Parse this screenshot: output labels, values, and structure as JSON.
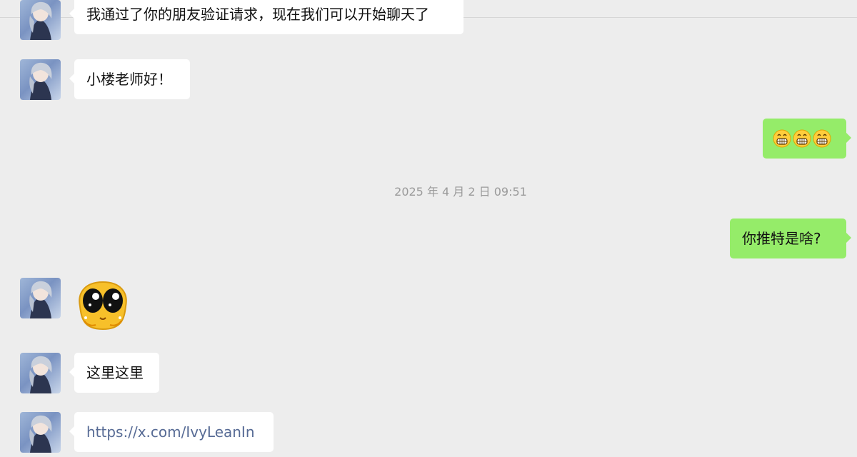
{
  "chat": {
    "messages": [
      {
        "side": "left",
        "type": "text",
        "text": "我通过了你的朋友验证请求，现在我们可以开始聊天了"
      },
      {
        "side": "left",
        "type": "text",
        "text": "小楼老师好！"
      },
      {
        "side": "right",
        "type": "emoji",
        "emoji": "grinning-face-icon",
        "count": 3
      },
      {
        "side": "center",
        "type": "timestamp",
        "text": "2025 年 4 月 2 日 09:51"
      },
      {
        "side": "right",
        "type": "text",
        "text": "你推特是啥?"
      },
      {
        "side": "left",
        "type": "sticker",
        "sticker": "pleading-eyes-sticker"
      },
      {
        "side": "left",
        "type": "text",
        "text": "这里这里"
      },
      {
        "side": "left",
        "type": "link",
        "text": "https://x.com/IvyLeanIn"
      }
    ]
  },
  "colors": {
    "background": "#ededed",
    "incoming_bubble": "#ffffff",
    "outgoing_bubble": "#95ec69",
    "link": "#576b95",
    "timestamp": "#9a9a9a"
  }
}
